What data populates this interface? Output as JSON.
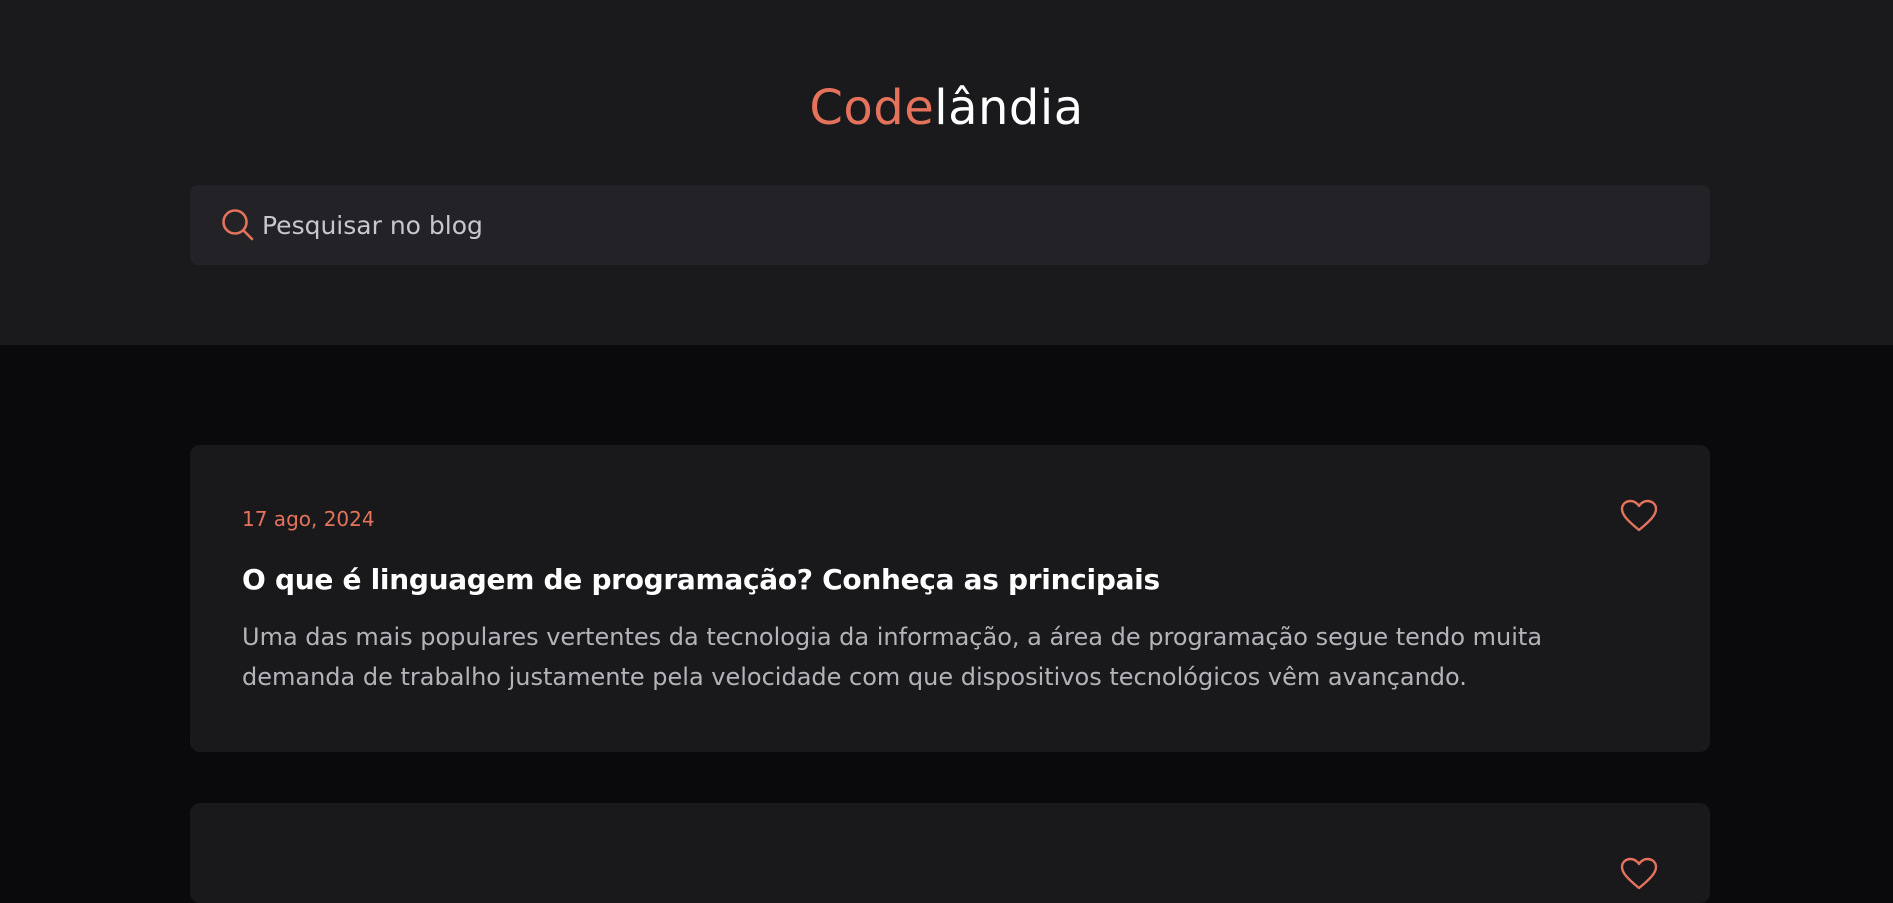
{
  "header": {
    "logo_accent": "Code",
    "logo_rest": "lândia",
    "accent_color": "#e5735c"
  },
  "search": {
    "placeholder": "Pesquisar no blog",
    "value": "",
    "icon": "search-icon"
  },
  "posts": [
    {
      "date": "17 ago, 2024",
      "title": "O que é linguagem de programação? Conheça as principais",
      "excerpt": "Uma das mais populares vertentes da tecnologia da informação, a área de programação segue tendo muita demanda de trabalho justamente pela velocidade com que dispositivos tecnológicos vêm avançando.",
      "like_icon": "heart-icon"
    },
    {
      "date": "",
      "title": "",
      "excerpt": "",
      "like_icon": "heart-icon"
    }
  ]
}
